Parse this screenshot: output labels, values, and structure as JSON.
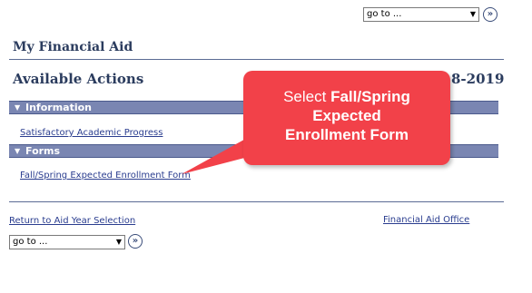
{
  "top_nav": {
    "select_value": "go to ...",
    "go_label": "»"
  },
  "header": {
    "title": "My Financial Aid"
  },
  "actions": {
    "title": "Available Actions",
    "year_fragment": "8-2019"
  },
  "sections": {
    "information": {
      "label": "Information",
      "link": "Satisfactory Academic Progress"
    },
    "forms": {
      "label": "Forms",
      "link": "Fall/Spring Expected Enrollment Form"
    }
  },
  "callout": {
    "line1_pre": "Select ",
    "line1_bold": "Fall/Spring",
    "line2": "Expected",
    "line3": "Enrollment Form",
    "color": "#f24149"
  },
  "footer": {
    "return_link": "Return to Aid Year Selection",
    "office_link": "Financial Aid Office",
    "select_value": "go to ...",
    "go_label": "»"
  }
}
